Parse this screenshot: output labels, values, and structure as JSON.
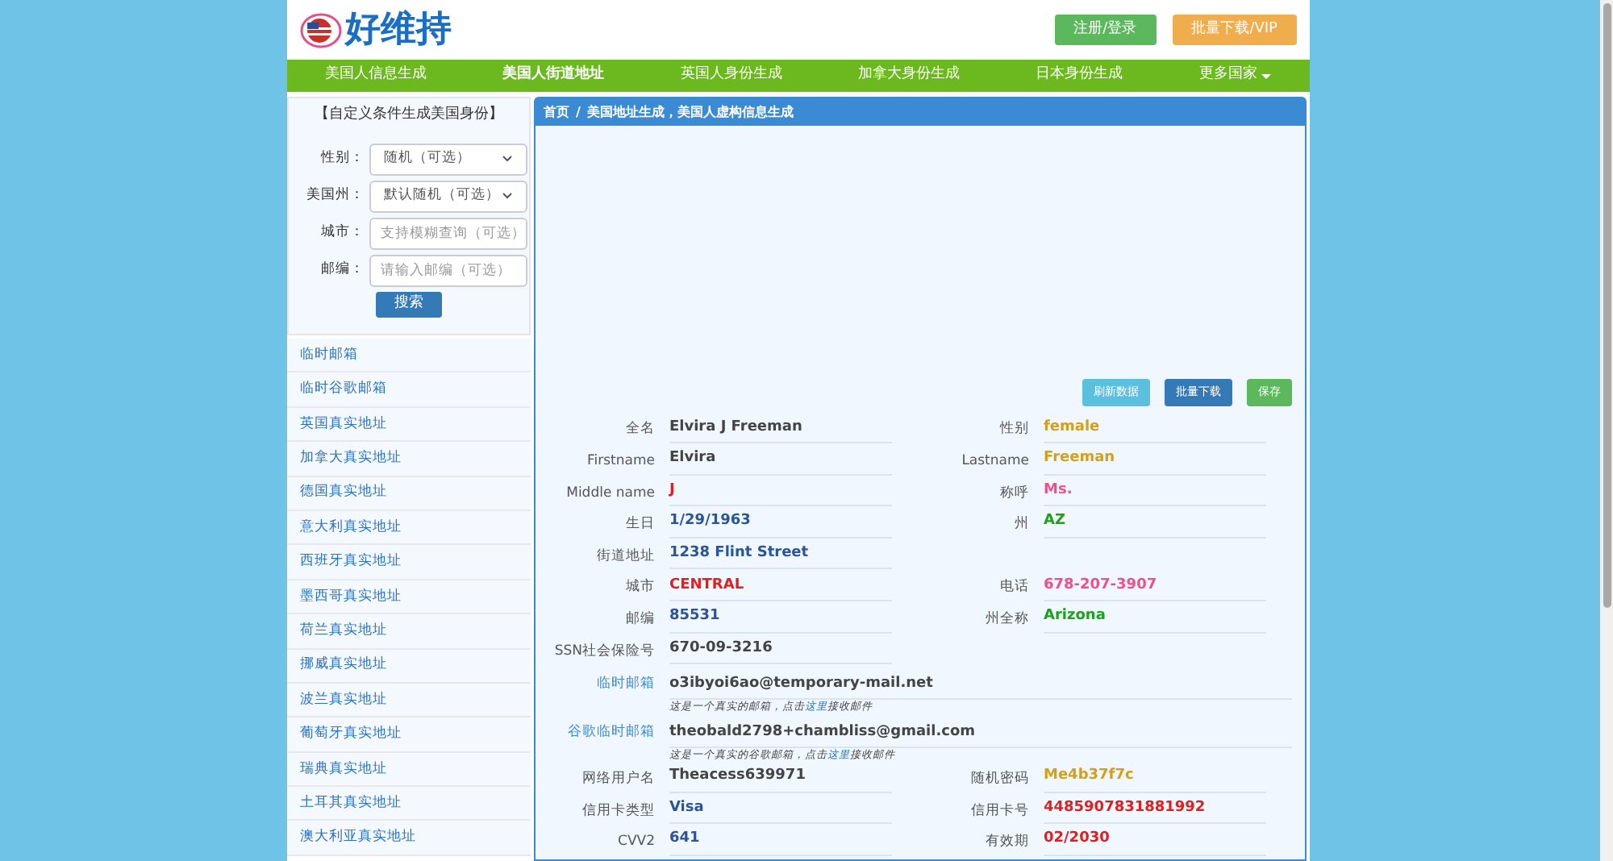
{
  "header": {
    "logo_text": "好维持",
    "buttons": [
      {
        "label": "注册/登录",
        "kind": "success"
      },
      {
        "label": "批量下载/VIP",
        "kind": "warning"
      }
    ]
  },
  "nav": [
    {
      "label": "美国人信息生成",
      "selected": false
    },
    {
      "label": "美国人街道地址",
      "selected": true
    },
    {
      "label": "英国人身份生成",
      "selected": false
    },
    {
      "label": "加拿大身份生成",
      "selected": false
    },
    {
      "label": "日本身份生成",
      "selected": false
    },
    {
      "label": "更多国家",
      "selected": false,
      "dropdown": true
    }
  ],
  "search_form": {
    "title": "【自定义条件生成美国身份】",
    "fields": [
      {
        "label": "性别：",
        "kind": "select",
        "value": "随机（可选）"
      },
      {
        "label": "美国州：",
        "kind": "select",
        "value": "默认随机（可选）"
      },
      {
        "label": "城市：",
        "kind": "input",
        "placeholder": "支持模糊查询（可选）"
      },
      {
        "label": "邮编：",
        "kind": "input",
        "placeholder": "请输入邮编（可选）"
      }
    ],
    "button": "搜索"
  },
  "sidebar_links": [
    "临时邮箱",
    "临时谷歌邮箱",
    "英国真实地址",
    "加拿大真实地址",
    "德国真实地址",
    "意大利真实地址",
    "西班牙真实地址",
    "墨西哥真实地址",
    "荷兰真实地址",
    "挪威真实地址",
    "波兰真实地址",
    "葡萄牙真实地址",
    "瑞典真实地址",
    "土耳其真实地址",
    "澳大利亚真实地址"
  ],
  "breadcrumb": [
    "首页",
    "美国地址生成，美国人虚构信息生成"
  ],
  "breadcrumb_separator": "/",
  "actions": [
    {
      "label": "刷新数据",
      "kind": "info"
    },
    {
      "label": "批量下载",
      "kind": "primary"
    },
    {
      "label": "保存",
      "kind": "success"
    }
  ],
  "rows": [
    {
      "kind": "pair",
      "left": {
        "label": "全名",
        "value": "Elvira J Freeman",
        "color": "#444444"
      },
      "right": {
        "label": "性别",
        "value": "female",
        "color": "#d4a017"
      }
    },
    {
      "kind": "pair",
      "left": {
        "label": "Firstname",
        "value": "Elvira",
        "color": "#444444"
      },
      "right": {
        "label": "Lastname",
        "value": "Freeman",
        "color": "#d4a017"
      }
    },
    {
      "kind": "pair",
      "left": {
        "label": "Middle name",
        "value": "J",
        "color": "#e02020"
      },
      "right": {
        "label": "称呼",
        "value": "Ms.",
        "color": "#f0508a"
      }
    },
    {
      "kind": "pair",
      "left": {
        "label": "生日",
        "value": "1/29/1963",
        "color": "#2a5599"
      },
      "right": {
        "label": "州",
        "value": "AZ",
        "color": "#1aa31a"
      }
    },
    {
      "kind": "pair",
      "left": {
        "label": "街道地址",
        "value": "1238 Flint Street",
        "color": "#2a5599"
      }
    },
    {
      "kind": "pair",
      "left": {
        "label": "城市",
        "value": "CENTRAL",
        "color": "#e02020"
      },
      "right": {
        "label": "电话",
        "value": "678-207-3907",
        "color": "#f0508a"
      }
    },
    {
      "kind": "pair",
      "left": {
        "label": "邮编",
        "value": "85531",
        "color": "#2a5599"
      },
      "right": {
        "label": "州全称",
        "value": "Arizona",
        "color": "#1aa31a"
      }
    },
    {
      "kind": "pair",
      "left": {
        "label": "SSN社会保险号",
        "value": "670-09-3216",
        "color": "#444444"
      }
    },
    {
      "kind": "email",
      "label": "临时邮箱",
      "value": "o3ibyoi6ao@temporary-mail.net",
      "note_start": "这是一个真实的邮箱，点击",
      "note_link": "这里",
      "note_end": "接收邮件"
    },
    {
      "kind": "email",
      "label": "谷歌临时邮箱",
      "value": "theobald2798+chambliss@gmail.com",
      "note_start": "这是一个真实的谷歌邮箱，点击",
      "note_link": "这里",
      "note_end": "接收邮件"
    },
    {
      "kind": "pair",
      "left": {
        "label": "网络用户名",
        "value": "Theacess639971",
        "color": "#444444"
      },
      "right": {
        "label": "随机密码",
        "value": "Me4b37f7c",
        "color": "#d4a017"
      }
    },
    {
      "kind": "pair",
      "left": {
        "label": "信用卡类型",
        "value": "Visa",
        "color": "#2a5599"
      },
      "right": {
        "label": "信用卡号",
        "value": "4485907831881992",
        "color": "#e02020"
      }
    },
    {
      "kind": "pair",
      "left": {
        "label": "CVV2",
        "value": "641",
        "color": "#2a5599"
      },
      "right": {
        "label": "有效期",
        "value": "02/2030",
        "color": "#e02020"
      }
    }
  ]
}
